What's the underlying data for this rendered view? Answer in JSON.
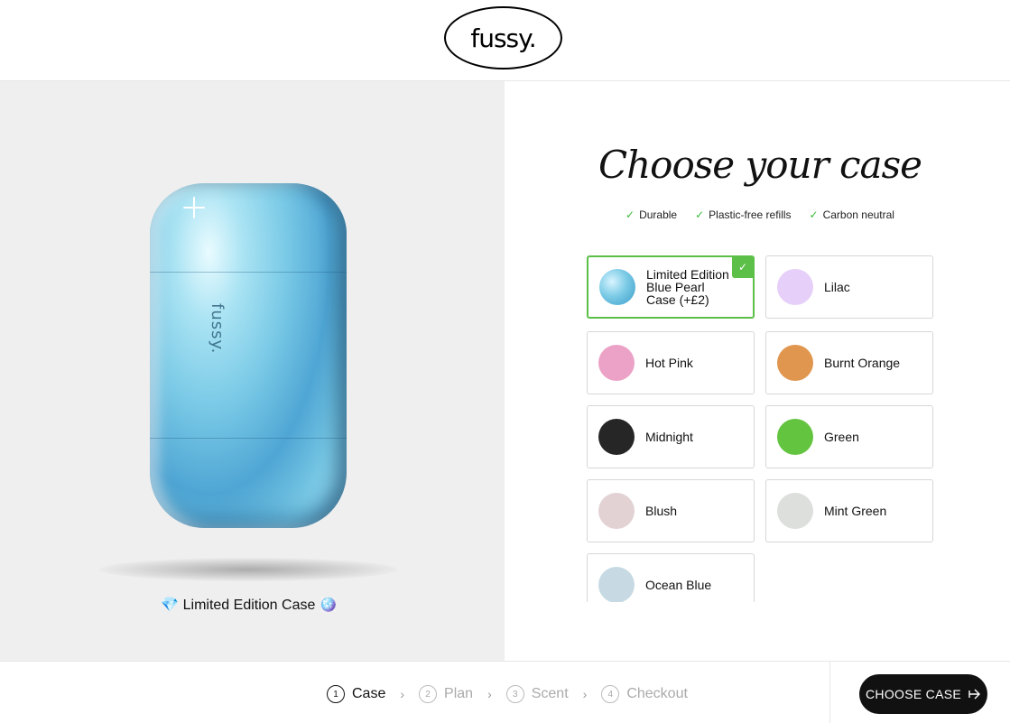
{
  "header": {
    "logo_text": "fussy."
  },
  "product": {
    "caption_prefix_icon": "💎",
    "caption": "Limited Edition Case",
    "caption_suffix_icon": "🪩",
    "case_logo": "fussy."
  },
  "picker": {
    "title": "Choose your case",
    "features": [
      {
        "icon": "check-icon",
        "label": "Durable"
      },
      {
        "icon": "check-icon",
        "label": "Plastic-free refills"
      },
      {
        "icon": "check-icon",
        "label": "Carbon neutral"
      }
    ],
    "options": [
      {
        "label": "Limited Edition Blue Pearl Case (+£2)",
        "color": "#6fc0dc",
        "selected": true
      },
      {
        "label": "Lilac",
        "color": "#e6cff8",
        "selected": false
      },
      {
        "label": "Hot Pink",
        "color": "#eba2c6",
        "selected": false
      },
      {
        "label": "Burnt Orange",
        "color": "#e0964e",
        "selected": false
      },
      {
        "label": "Midnight",
        "color": "#262626",
        "selected": false
      },
      {
        "label": "Green",
        "color": "#63c43f",
        "selected": false
      },
      {
        "label": "Blush",
        "color": "#e2d2d4",
        "selected": false
      },
      {
        "label": "Mint Green",
        "color": "#dcdfdc",
        "selected": false
      },
      {
        "label": "Ocean Blue",
        "color": "#c7dae3",
        "selected": false
      }
    ]
  },
  "footer": {
    "steps": [
      {
        "num": "1",
        "label": "Case",
        "active": true
      },
      {
        "num": "2",
        "label": "Plan",
        "active": false
      },
      {
        "num": "3",
        "label": "Scent",
        "active": false
      },
      {
        "num": "4",
        "label": "Checkout",
        "active": false
      }
    ],
    "step_separator": "›",
    "cta_label": "CHOOSE CASE",
    "cta_icon": "arrow-right-icon"
  },
  "colors": {
    "accent_green": "#5cc048",
    "cta_bg": "#111111"
  }
}
